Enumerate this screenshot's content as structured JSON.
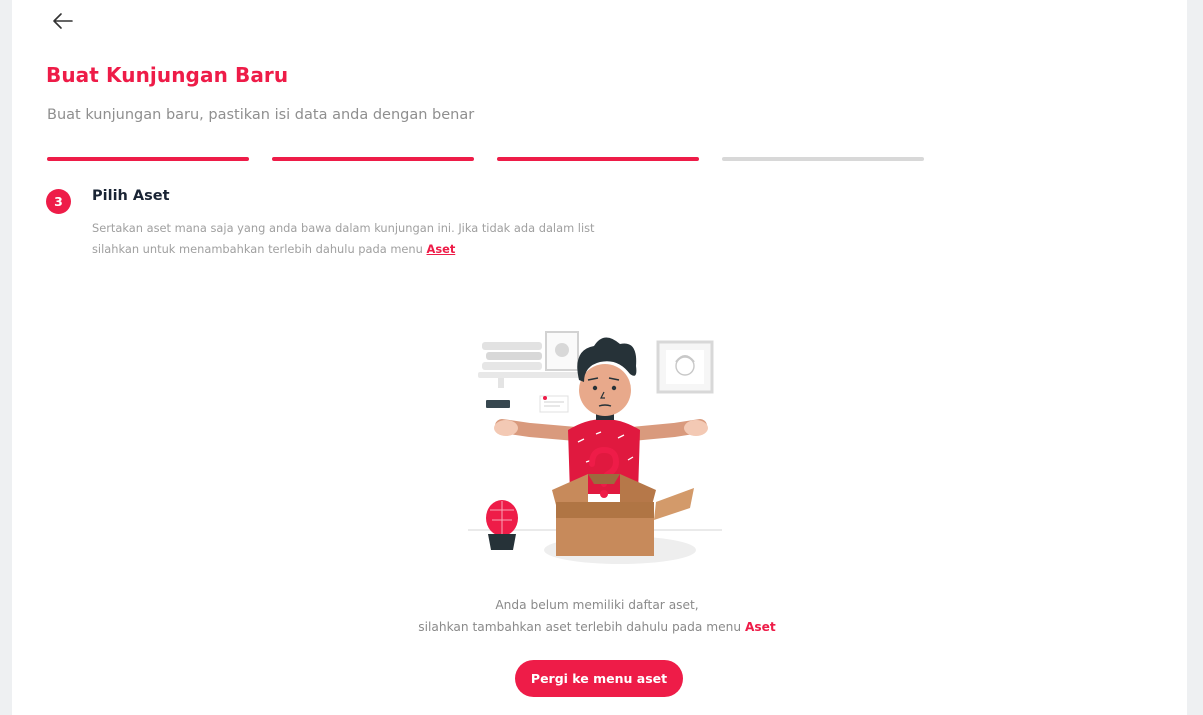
{
  "header": {
    "back_icon": "arrow-left-icon",
    "title": "Buat Kunjungan Baru",
    "subtitle": "Buat kunjungan baru, pastikan isi data anda dengan benar"
  },
  "stepper": {
    "total_steps": 4,
    "completed_steps": 3,
    "active_color": "#ee1c48",
    "inactive_color": "#d8d8d8"
  },
  "step": {
    "number": "3",
    "title": "Pilih Aset",
    "description_1": "Sertakan aset mana saja yang anda bawa dalam kunjungan ini. Jika tidak ada dalam list",
    "description_2": "silahkan untuk menambahkan terlebih dahulu pada menu",
    "link_label": "Aset"
  },
  "empty_state": {
    "illustration": "confused-person-empty-box-illustration",
    "line_1": "Anda belum memiliki daftar aset,",
    "line_2": "silahkan tambahkan aset terlebih dahulu pada menu",
    "link_label": "Aset",
    "button_label": "Pergi ke menu aset"
  }
}
